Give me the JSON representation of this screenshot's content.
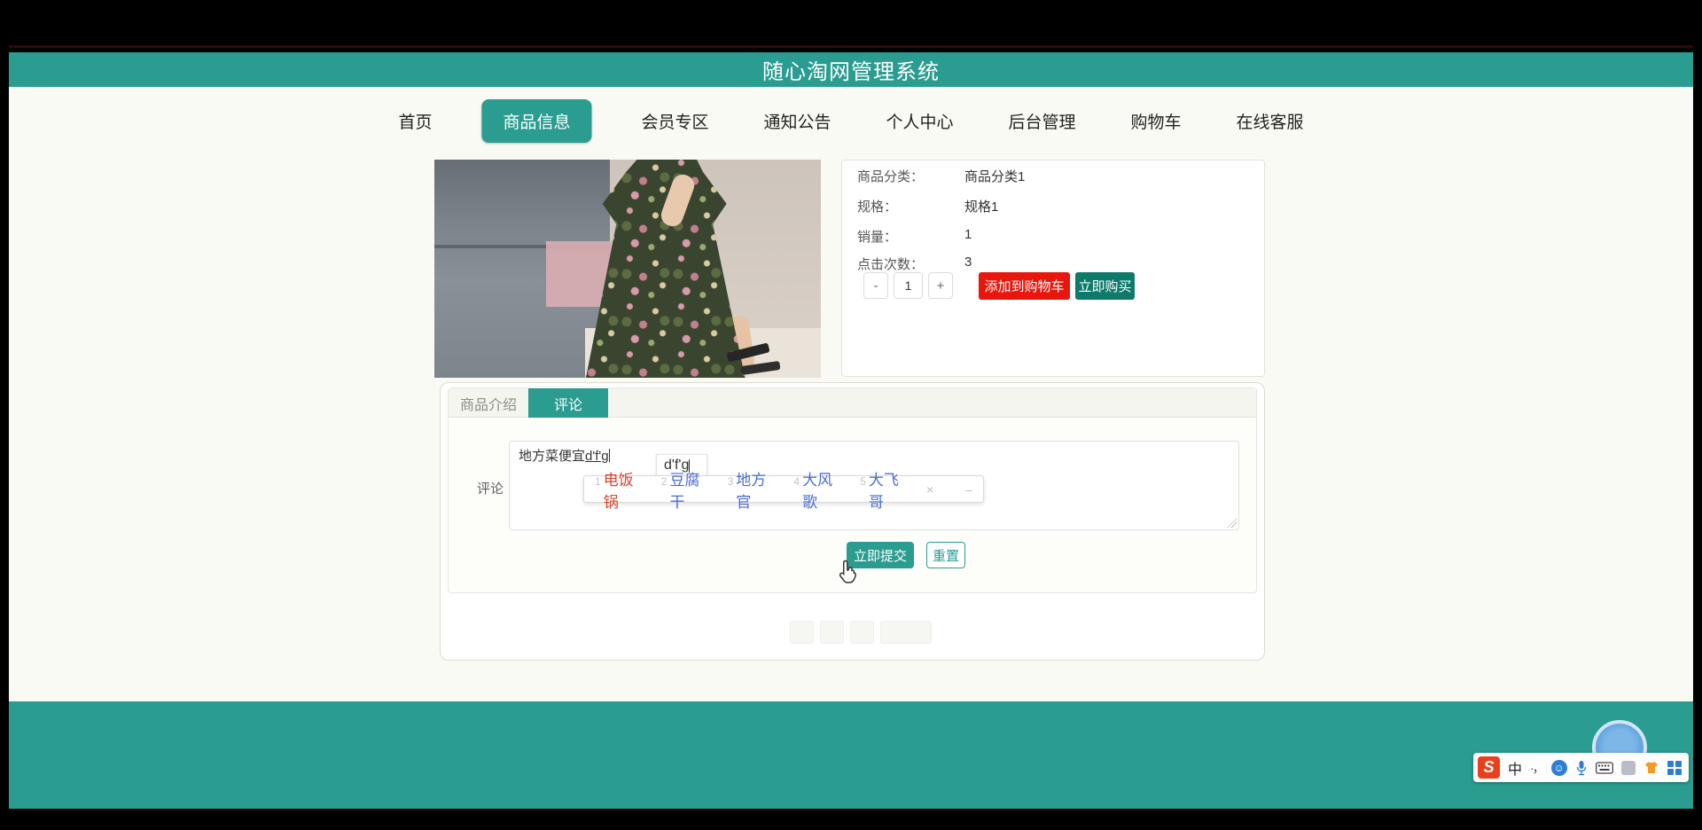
{
  "header": {
    "title": "随心淘网管理系统"
  },
  "nav": {
    "items": [
      {
        "label": "首页",
        "active": false
      },
      {
        "label": "商品信息",
        "active": true
      },
      {
        "label": "会员专区",
        "active": false
      },
      {
        "label": "通知公告",
        "active": false
      },
      {
        "label": "个人中心",
        "active": false
      },
      {
        "label": "后台管理",
        "active": false
      },
      {
        "label": "购物车",
        "active": false
      },
      {
        "label": "在线客服",
        "active": false
      }
    ]
  },
  "product": {
    "details": [
      {
        "label": "商品分类：",
        "value": "商品分类1"
      },
      {
        "label": "规格：",
        "value": "规格1"
      },
      {
        "label": "销量：",
        "value": "1"
      },
      {
        "label": "点击次数：",
        "value": "3"
      }
    ],
    "stepper": {
      "minus": "-",
      "value": "1",
      "plus": "+"
    },
    "add_to_cart_label": "添加到购物车",
    "buy_now_label": "立即购买"
  },
  "tabs": [
    {
      "label": "商品介绍",
      "active": false
    },
    {
      "label": "评论",
      "active": true
    }
  ],
  "comment_form": {
    "label": "评论",
    "textarea_text": "地方菜便宜",
    "ime_inline": "d'f'g",
    "submit_label": "立即提交",
    "reset_label": "重置"
  },
  "ime": {
    "composition": "d'f'g",
    "candidates": [
      {
        "n": "1",
        "text": "电饭锅"
      },
      {
        "n": "2",
        "text": "豆腐干"
      },
      {
        "n": "3",
        "text": "地方官"
      },
      {
        "n": "4",
        "text": "大风歌"
      },
      {
        "n": "5",
        "text": "大飞哥"
      }
    ],
    "close": "×",
    "minimize": "–",
    "toolbar": {
      "logo": "S",
      "mode": "中",
      "punct": "·，"
    }
  },
  "colors": {
    "teal": "#2a9c90",
    "buy_now_teal": "#0e7a6b",
    "add_cart_red": "#e8160c",
    "candidate_blue": "#4a6cd4",
    "candidate_first_red": "#d9442c"
  }
}
